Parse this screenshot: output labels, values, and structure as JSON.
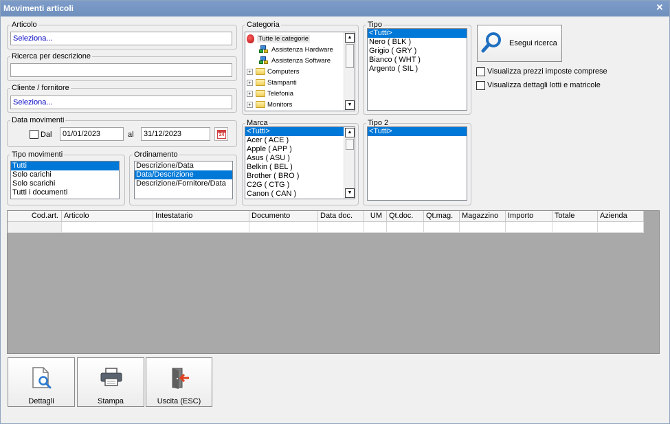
{
  "window": {
    "title": "Movimenti articoli"
  },
  "articolo": {
    "legend": "Articolo",
    "value": "Seleziona..."
  },
  "ricerca": {
    "legend": "Ricerca per descrizione",
    "value": ""
  },
  "cliente": {
    "legend": "Cliente / fornitore",
    "value": "Seleziona..."
  },
  "data_movimenti": {
    "legend": "Data movimenti",
    "dal_label": "Dal",
    "al_label": "al",
    "from": "01/01/2023",
    "to": "31/12/2023",
    "calendar_day": "24"
  },
  "tipo_movimenti": {
    "legend": "Tipo movimenti",
    "items": [
      "Tutti",
      "Solo carichi",
      "Solo scarichi",
      "Tutti i documenti"
    ],
    "selected": 0
  },
  "ordinamento": {
    "legend": "Ordinamento",
    "items": [
      "Descrizione/Data",
      "Data/Descrizione",
      "Descrizione/Fornitore/Data"
    ],
    "selected": 1
  },
  "categoria": {
    "legend": "Categoria",
    "root": "Tutte le categorie",
    "items": [
      {
        "label": "Assistenza Hardware",
        "icon": "network-icon",
        "expandable": false
      },
      {
        "label": "Assistenza Software",
        "icon": "network-icon",
        "expandable": false
      },
      {
        "label": "Computers",
        "icon": "folder-icon",
        "expandable": true
      },
      {
        "label": "Stampanti",
        "icon": "folder-icon",
        "expandable": true
      },
      {
        "label": "Telefonia",
        "icon": "folder-icon",
        "expandable": true
      },
      {
        "label": "Monitors",
        "icon": "folder-icon",
        "expandable": true
      }
    ]
  },
  "marca": {
    "legend": "Marca",
    "items": [
      "<Tutti>",
      "Acer ( ACE )",
      "Apple ( APP )",
      "Asus ( ASU )",
      "Belkin ( BEL )",
      "Brother ( BRO )",
      "C2G ( CTG )",
      "Canon ( CAN )"
    ],
    "selected": 0
  },
  "tipo": {
    "legend": "Tipo",
    "items": [
      "<Tutti>",
      "Nero ( BLK )",
      "Grigio ( GRY )",
      "Bianco ( WHT )",
      "Argento ( SIL )"
    ],
    "selected": 0
  },
  "tipo2": {
    "legend": "Tipo 2",
    "items": [
      "<Tutti>"
    ],
    "selected": 0
  },
  "search_button": {
    "label": "Esegui ricerca"
  },
  "options": {
    "prezzi_label": "Visualizza prezzi imposte comprese",
    "lotti_label": "Visualizza dettagli lotti e matricole"
  },
  "grid": {
    "columns": [
      "Cod.art.",
      "Articolo",
      "Intestatario",
      "Documento",
      "Data doc.",
      "UM",
      "Qt.doc.",
      "Qt.mag.",
      "Magazzino",
      "Importo",
      "Totale",
      "Azienda"
    ]
  },
  "footer": {
    "dettagli_label": "Dettagli",
    "stampa_label": "Stampa",
    "uscita_label": "Uscita (ESC)"
  },
  "colors": {
    "selection": "#0078d7",
    "titlebar": "#7396c4",
    "grid_bg": "#a9a9a9",
    "placeholder": "#0000c0"
  }
}
